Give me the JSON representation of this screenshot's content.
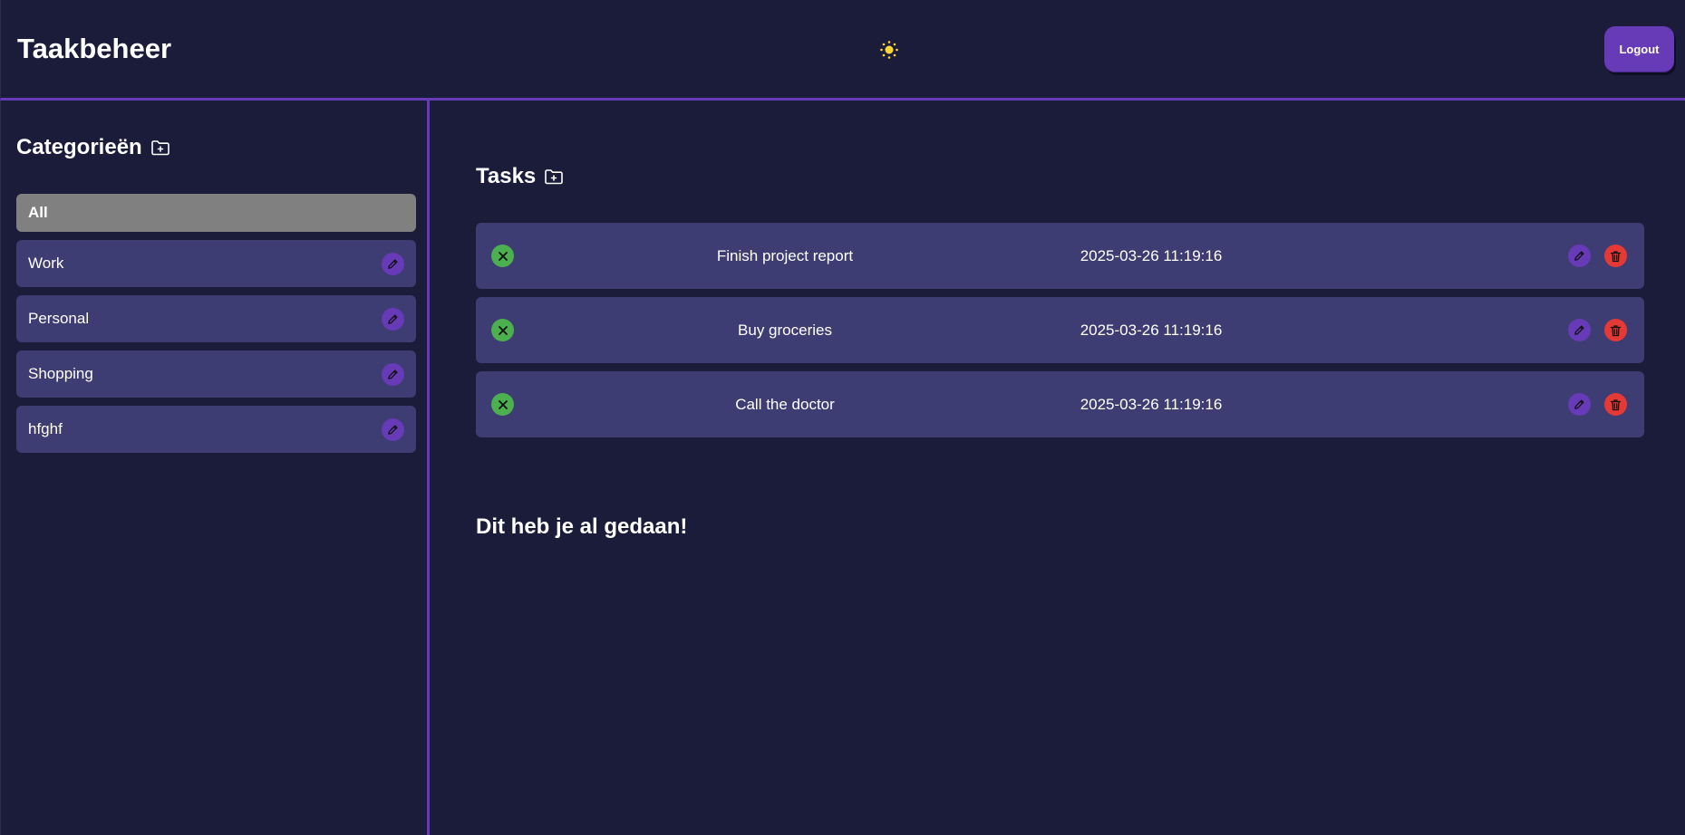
{
  "header": {
    "title": "Taakbeheer",
    "theme_icon": "sun-icon",
    "logout_label": "Logout"
  },
  "sidebar": {
    "heading": "Categorieën",
    "add_icon": "folder-plus-icon",
    "items": [
      {
        "label": "All",
        "selected": true
      },
      {
        "label": "Work",
        "edit_icon": "pencil-icon"
      },
      {
        "label": "Personal",
        "edit_icon": "pencil-icon"
      },
      {
        "label": "Shopping",
        "edit_icon": "pencil-icon"
      },
      {
        "label": "hfghf",
        "edit_icon": "pencil-icon"
      }
    ]
  },
  "main": {
    "tasks_heading": "Tasks",
    "add_icon": "folder-plus-icon",
    "tasks": [
      {
        "title": "Finish project report",
        "date": "2025-03-26 11:19:16"
      },
      {
        "title": "Buy groceries",
        "date": "2025-03-26 11:19:16"
      },
      {
        "title": "Call the doctor",
        "date": "2025-03-26 11:19:16"
      }
    ],
    "done_heading": "Dit heb je al gedaan!"
  },
  "colors": {
    "background": "#1b1b3a",
    "card": "#3d3d73",
    "accent": "#673ab7",
    "selected": "#808080",
    "complete": "#4caf50",
    "delete": "#e53935",
    "sun": "#fdd835"
  }
}
